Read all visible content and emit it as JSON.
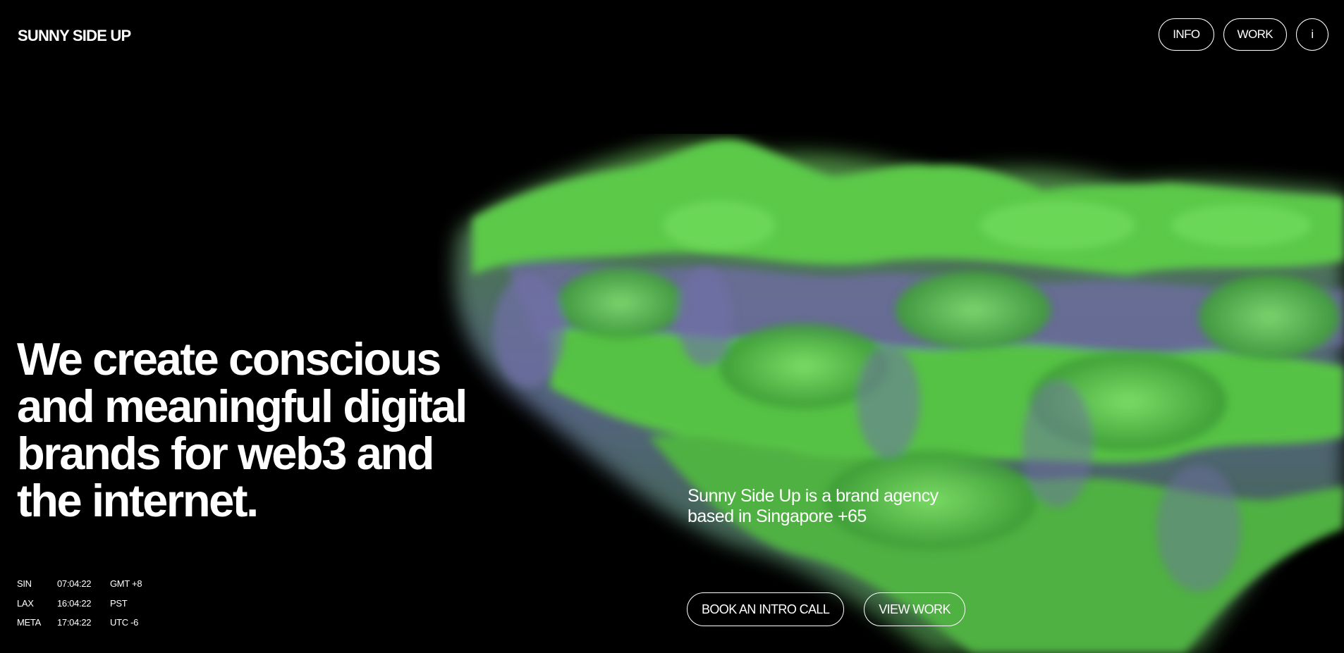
{
  "header": {
    "logo": "SUNNY SIDE UP",
    "nav": [
      {
        "label": "INFO"
      },
      {
        "label": "WORK"
      },
      {
        "label": "i"
      }
    ]
  },
  "hero": {
    "headline_lines": [
      "We create conscious",
      "and meaningful digital",
      "brands for web3 and",
      "the internet."
    ],
    "tagline_lines": [
      "Sunny Side Up is a brand agency",
      "based in Singapore +65"
    ],
    "cta_primary": "BOOK AN INTRO CALL",
    "cta_secondary": "VIEW WORK"
  },
  "clocks": [
    {
      "city": "SIN",
      "time": "07:04:22",
      "zone": "GMT +8"
    },
    {
      "city": "LAX",
      "time": "16:04:22",
      "zone": "PST"
    },
    {
      "city": "META",
      "time": "17:04:22",
      "zone": "UTC -6"
    }
  ],
  "colors": {
    "background": "#000000",
    "text": "#ffffff",
    "terrain_green": "#5fd24a",
    "terrain_purple": "#6b6a9a"
  }
}
